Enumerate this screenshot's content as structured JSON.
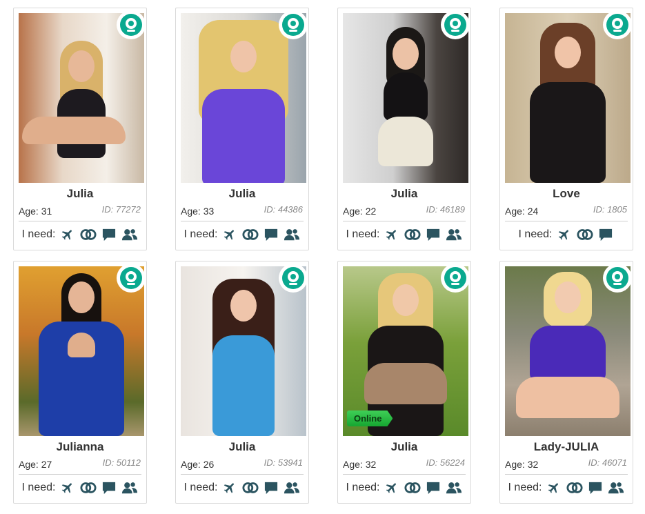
{
  "labels": {
    "age_prefix": "Age:",
    "id_prefix": "ID:",
    "need": "I need:"
  },
  "colors": {
    "accent": "#0aa98f",
    "icon": "#2b5460",
    "online": "#1fb83d"
  },
  "profiles": [
    {
      "name": "Julia",
      "age": "Age: 31",
      "id": "ID: 77272",
      "webcam": true,
      "online": false,
      "needs": [
        "plane-icon",
        "rings-icon",
        "chat-icon",
        "users-icon"
      ]
    },
    {
      "name": "Julia",
      "age": "Age: 33",
      "id": "ID: 44386",
      "webcam": true,
      "online": false,
      "needs": [
        "plane-icon",
        "rings-icon",
        "chat-icon",
        "users-icon"
      ]
    },
    {
      "name": "Julia",
      "age": "Age: 22",
      "id": "ID: 46189",
      "webcam": true,
      "online": false,
      "needs": [
        "plane-icon",
        "rings-icon",
        "chat-icon",
        "users-icon"
      ]
    },
    {
      "name": "Love",
      "age": "Age: 24",
      "id": "ID: 1805",
      "webcam": true,
      "online": false,
      "needs": [
        "plane-icon",
        "rings-icon",
        "chat-icon"
      ]
    },
    {
      "name": "Julianna",
      "age": "Age: 27",
      "id": "ID: 50112",
      "webcam": true,
      "online": false,
      "needs": [
        "plane-icon",
        "rings-icon",
        "chat-icon",
        "users-icon"
      ]
    },
    {
      "name": "Julia",
      "age": "Age: 26",
      "id": "ID: 53941",
      "webcam": true,
      "online": false,
      "needs": [
        "plane-icon",
        "rings-icon",
        "chat-icon",
        "users-icon"
      ]
    },
    {
      "name": "Julia",
      "age": "Age: 32",
      "id": "ID: 56224",
      "webcam": true,
      "online": true,
      "online_label": "Online",
      "needs": [
        "plane-icon",
        "rings-icon",
        "chat-icon",
        "users-icon"
      ]
    },
    {
      "name": "Lady-JULIA",
      "age": "Age: 32",
      "id": "ID: 46071",
      "webcam": true,
      "online": false,
      "needs": [
        "plane-icon",
        "rings-icon",
        "chat-icon",
        "users-icon"
      ]
    }
  ]
}
